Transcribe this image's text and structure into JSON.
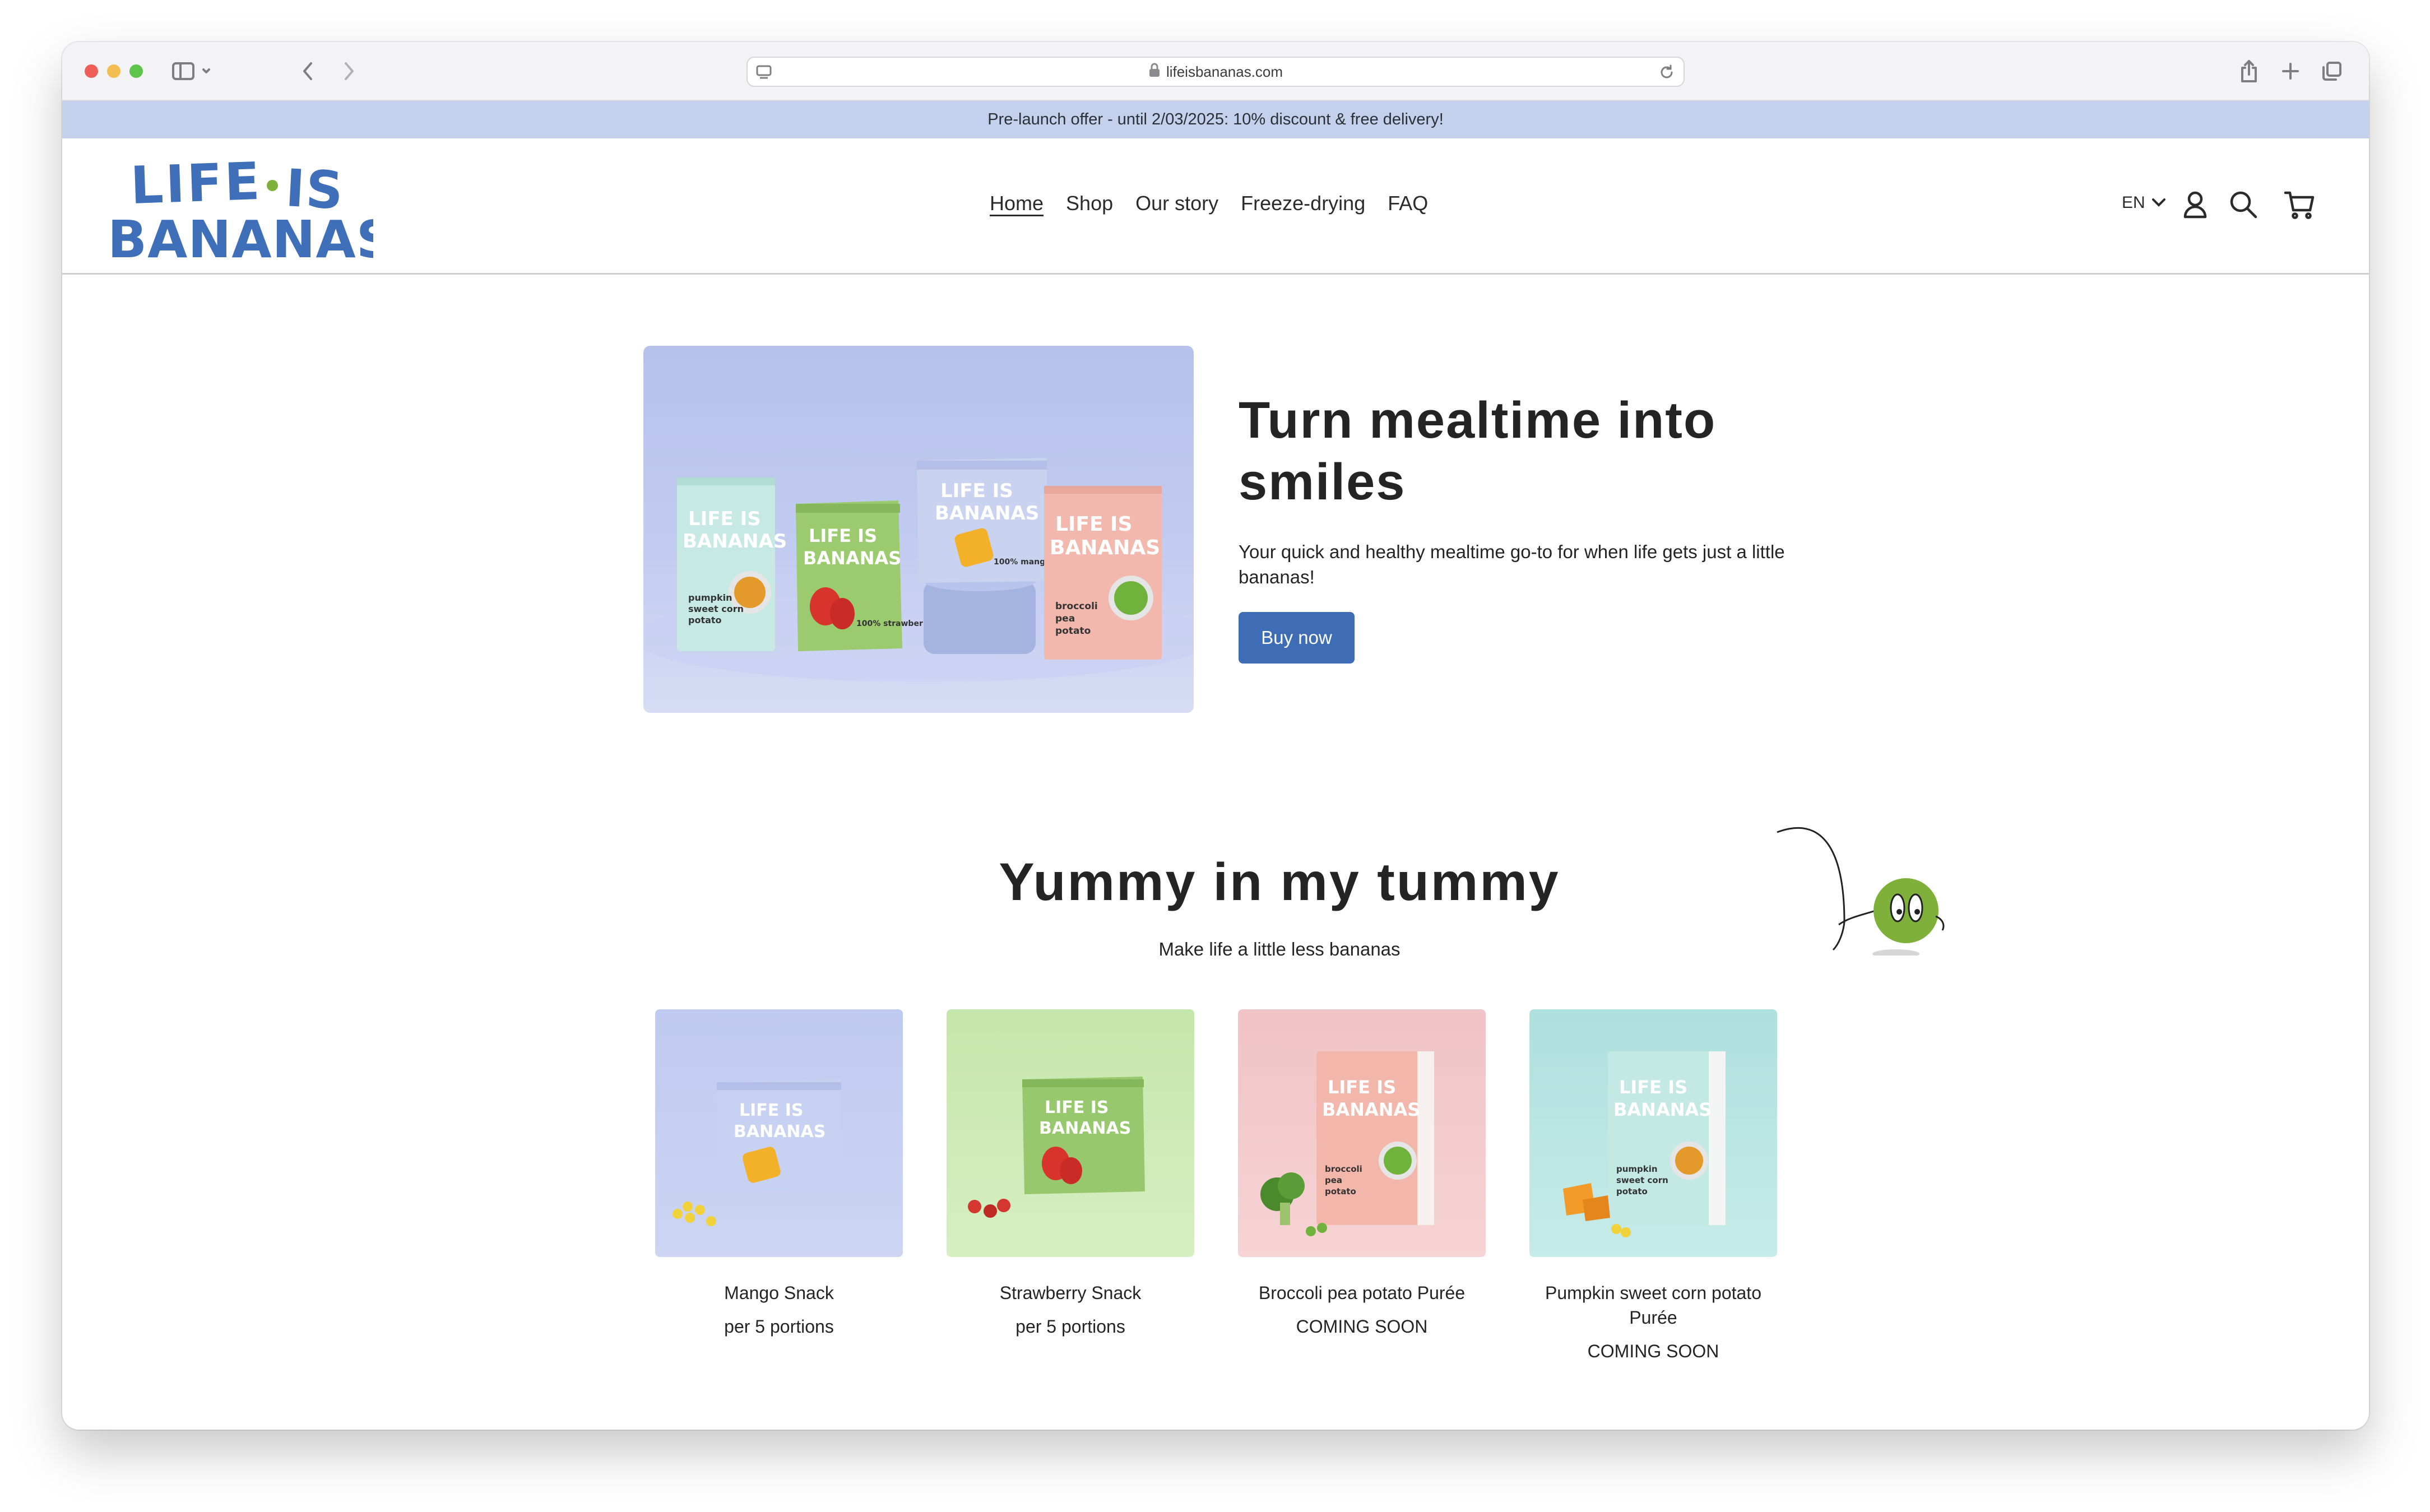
{
  "browser": {
    "url": "lifeisbananas.com"
  },
  "announcement": "Pre-launch offer - until 2/03/2025: 10% discount & free delivery!",
  "header": {
    "logo_line1": "LIFE IS",
    "logo_line2": "BANANAS",
    "nav": [
      "Home",
      "Shop",
      "Our story",
      "Freeze-drying",
      "FAQ"
    ],
    "active_nav": "Home",
    "language": "EN"
  },
  "hero": {
    "title": "Turn mealtime into smiles",
    "subtitle": "Your quick and healthy mealtime go-to for when life gets just a little bananas!",
    "cta": "Buy now"
  },
  "featured": {
    "title": "Yummy in my tummy",
    "subtitle": "Make life a little less bananas",
    "products": [
      {
        "name": "Mango Snack",
        "detail": "per 5 portions",
        "bg": "#c2cbef",
        "pack": "#c9d3f0",
        "fruit": "#f3b12a"
      },
      {
        "name": "Strawberry Snack",
        "detail": "per 5 portions",
        "bg": "#cbe8b4",
        "pack": "#97c86d",
        "fruit": "#d8332d"
      },
      {
        "name": "Broccoli pea potato Purée",
        "detail": "COMING SOON",
        "bg": "#f2c9cc",
        "pack": "#f0b8ae",
        "fruit": "#4a8a2d"
      },
      {
        "name": "Pumpkin sweet corn potato Purée",
        "detail": "COMING SOON",
        "bg": "#b7e4e2",
        "pack": "#c4e8e3",
        "fruit": "#f29a2a"
      }
    ]
  },
  "colors": {
    "brand_blue": "#3e6db5",
    "logo_blue": "#3f6fb8",
    "announcement_bg": "#c3d1ec",
    "mascot_green": "#7fb13a"
  }
}
